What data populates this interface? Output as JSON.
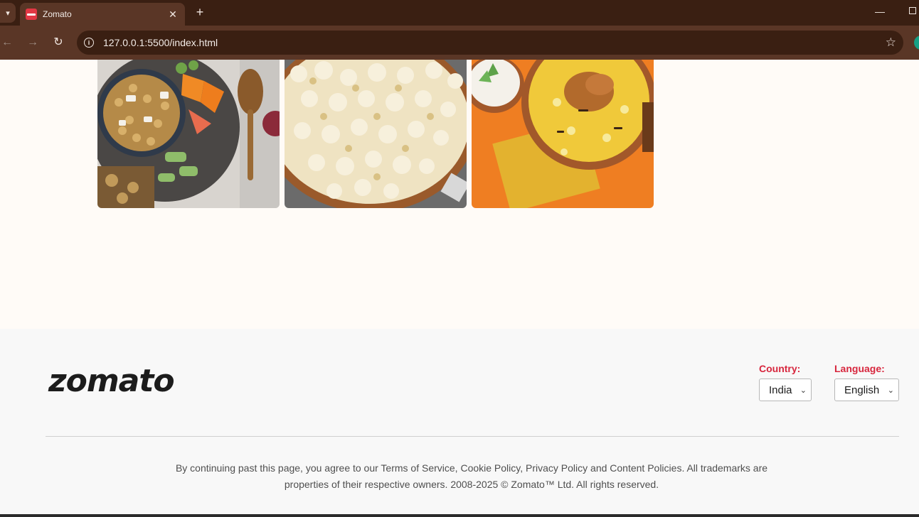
{
  "browser": {
    "tab_title": "Zomato",
    "tab_close": "✕",
    "new_tab": "+",
    "url": "127.0.0.1:5500/index.html",
    "icons": [
      "tab-list-icon",
      "zomato-favicon",
      "close-icon",
      "plus-icon",
      "back-icon",
      "forward-icon",
      "reload-icon",
      "info-icon",
      "star-icon",
      "minimize-icon",
      "restore-icon"
    ]
  },
  "gallery": {
    "items": [
      {
        "name": "chickpea-bowl-image",
        "palette": [
          "#3b3b3b",
          "#c9a15a",
          "#ef8d2f",
          "#6fa348"
        ]
      },
      {
        "name": "popcorn-image",
        "palette": [
          "#f4ecd4",
          "#d9c184",
          "#9a5a2b"
        ]
      },
      {
        "name": "biryani-image",
        "palette": [
          "#ef7e22",
          "#f3d23d",
          "#b26a2c",
          "#f4f1ea"
        ]
      }
    ]
  },
  "footer": {
    "logo": "zomato",
    "country_label": "Country:",
    "country_value": "India",
    "language_label": "Language:",
    "language_value": "English",
    "legal_line1": "By continuing past this page, you agree to our Terms of Service, Cookie Policy, Privacy Policy and Content Policies. All trademarks are",
    "legal_line2": "properties of their respective owners. 2008-2025 © Zomato™ Ltd. All rights reserved."
  },
  "colors": {
    "accent": "#d7263d",
    "brand": "#e23744",
    "chrome_dark": "#3a1f12",
    "chrome_light": "#5a3626",
    "page_bg": "#fffbf7",
    "footer_bg": "#f8f8f8"
  }
}
